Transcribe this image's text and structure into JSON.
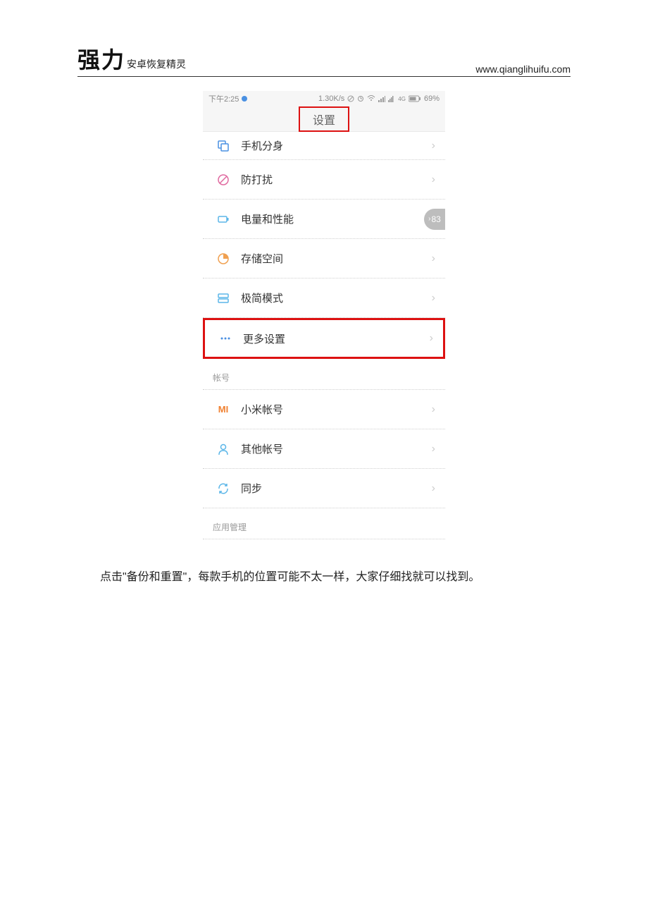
{
  "header": {
    "brand_big": "强力",
    "brand_small": "安卓恢复精灵",
    "url": "www.qianglihuifu.com"
  },
  "screenshot": {
    "status": {
      "time": "下午2:25",
      "speed": "1.30K/s",
      "battery": "69%",
      "net_label": "4G"
    },
    "title": "设置",
    "items": [
      {
        "icon": "clone-icon",
        "label": "手机分身",
        "color": "#4a90e2",
        "badge": null
      },
      {
        "icon": "block-icon",
        "label": "防打扰",
        "color": "#e06aa0",
        "badge": null
      },
      {
        "icon": "battery-icon",
        "label": "电量和性能",
        "color": "#5bb6e8",
        "badge": "83"
      },
      {
        "icon": "storage-icon",
        "label": "存储空间",
        "color": "#f0a050",
        "badge": null
      },
      {
        "icon": "simple-icon",
        "label": "极简模式",
        "color": "#5bb6e8",
        "badge": null
      },
      {
        "icon": "more-icon",
        "label": "更多设置",
        "color": "#4a90e2",
        "badge": null,
        "highlight": true
      }
    ],
    "section_account": "帐号",
    "account_items": [
      {
        "icon": "mi-icon",
        "label": "小米帐号",
        "color": "#f08030"
      },
      {
        "icon": "user-icon",
        "label": "其他帐号",
        "color": "#5bb6e8"
      },
      {
        "icon": "sync-icon",
        "label": "同步",
        "color": "#5bb6e8"
      }
    ],
    "section_apps": "应用管理"
  },
  "caption": "点击\"备份和重置\"，每款手机的位置可能不太一样，大家仔细找就可以找到。"
}
